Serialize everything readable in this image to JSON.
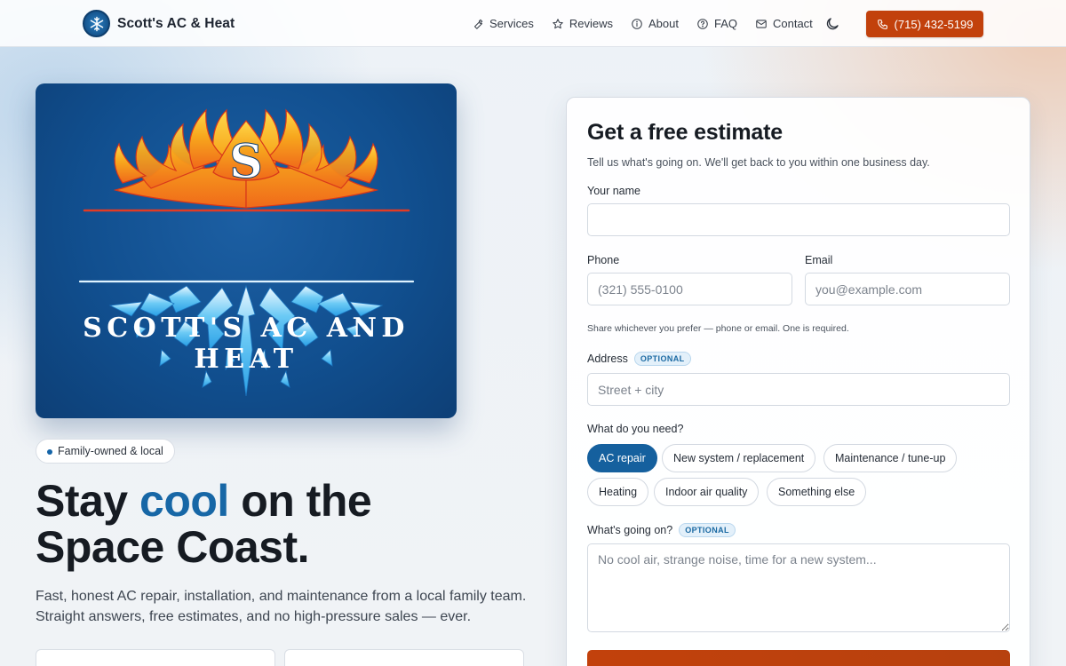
{
  "nav": {
    "brand": "Scott's AC & Heat",
    "links": [
      {
        "label": "Services",
        "icon": "wrench-icon"
      },
      {
        "label": "Reviews",
        "icon": "star-icon"
      },
      {
        "label": "About",
        "icon": "info-icon"
      },
      {
        "label": "FAQ",
        "icon": "help-circle-icon"
      },
      {
        "label": "Contact",
        "icon": "mail-icon"
      }
    ],
    "theme_icon": "moon-icon",
    "call_label": "(715) 432-5199"
  },
  "hero": {
    "logo_text": "SCOTT'S AC AND HEAT",
    "logo_monogram": "S",
    "badge": "Family-owned & local",
    "headline_pre": "Stay ",
    "headline_accent": "cool",
    "headline_post": " on the",
    "headline_line2": "Space Coast.",
    "subtitle": "Fast, honest AC repair, installation, and maintenance from a local family team. Straight answers, free estimates, and no high-pressure sales — ever."
  },
  "form": {
    "title": "Get a free estimate",
    "subtitle": "Tell us what's going on. We'll get back to you within one business day.",
    "name_label": "Your name",
    "name_value": "",
    "phone_label": "Phone",
    "phone_placeholder": "(321) 555-0100",
    "email_label": "Email",
    "email_placeholder": "you@example.com",
    "contact_hint": "Share whichever you prefer — phone or email. One is required.",
    "address_label": "Address",
    "optional_badge": "OPTIONAL",
    "address_placeholder": "Street + city",
    "need_label": "What do you need?",
    "needs": [
      "AC repair",
      "New system / replacement",
      "Maintenance / tune-up",
      "Heating",
      "Indoor air quality",
      "Something else"
    ],
    "selected_need": "AC repair",
    "details_label": "What's going on?",
    "details_placeholder": "No cool air, strange noise, time for a new system..."
  },
  "colors": {
    "accent_blue": "#15609e",
    "cta_orange": "#c2410c"
  }
}
